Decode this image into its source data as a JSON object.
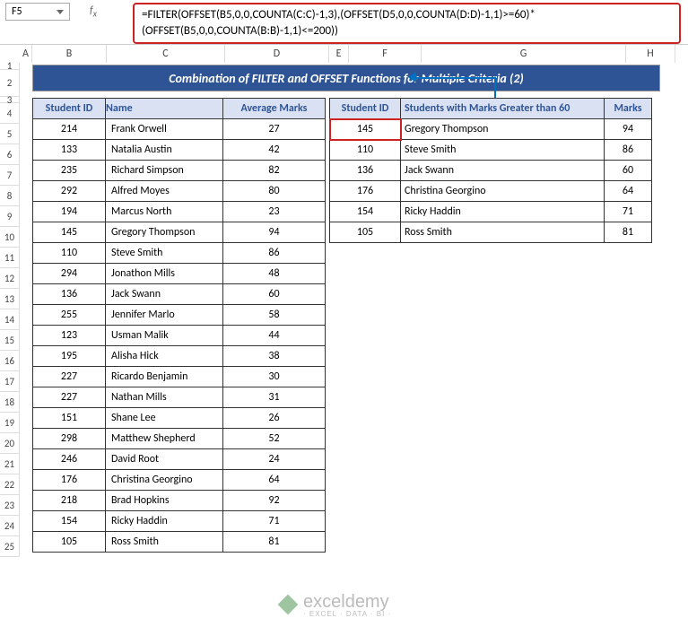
{
  "nameBox": "F5",
  "formula": "=FILTER(OFFSET(B5,0,0,COUNTA(C:C)-1,3),(OFFSET(D5,0,0,COUNTA(D:D)-1,1)>=60)*(OFFSET(B5,0,0,COUNTA(B:B)-1,1)<=200))",
  "cols": [
    "A",
    "B",
    "C",
    "D",
    "E",
    "F",
    "G",
    "H"
  ],
  "rowNums": [
    "1",
    "2",
    "3",
    "4",
    "5",
    "6",
    "7",
    "8",
    "9",
    "10",
    "11",
    "12",
    "13",
    "14",
    "15",
    "16",
    "17",
    "18",
    "19",
    "20",
    "21",
    "22",
    "23",
    "24",
    "25"
  ],
  "title": "Combination of FILTER and OFFSET Functions for Multiple Criteria (2)",
  "t1h": {
    "id": "Student ID",
    "name": "Name",
    "am": "Average Marks"
  },
  "t1": [
    {
      "id": "214",
      "name": "Frank Orwell",
      "am": "27"
    },
    {
      "id": "133",
      "name": "Natalia Austin",
      "am": "42"
    },
    {
      "id": "235",
      "name": "Richard Simpson",
      "am": "82"
    },
    {
      "id": "292",
      "name": "Alfred Moyes",
      "am": "80"
    },
    {
      "id": "194",
      "name": "Marcus North",
      "am": "23"
    },
    {
      "id": "145",
      "name": "Gregory Thompson",
      "am": "94"
    },
    {
      "id": "110",
      "name": "Steve Smith",
      "am": "86"
    },
    {
      "id": "294",
      "name": "Jonathon Mills",
      "am": "48"
    },
    {
      "id": "136",
      "name": "Jack Swann",
      "am": "60"
    },
    {
      "id": "255",
      "name": "Jennifer Marlo",
      "am": "58"
    },
    {
      "id": "123",
      "name": "Usman Malik",
      "am": "44"
    },
    {
      "id": "195",
      "name": "Alisha Hick",
      "am": "38"
    },
    {
      "id": "227",
      "name": "Ricardo Benjamin",
      "am": "30"
    },
    {
      "id": "227",
      "name": "Nathan Mills",
      "am": "31"
    },
    {
      "id": "151",
      "name": "Shane Lee",
      "am": "26"
    },
    {
      "id": "298",
      "name": "Matthew Shepherd",
      "am": "52"
    },
    {
      "id": "246",
      "name": "David Root",
      "am": "24"
    },
    {
      "id": "176",
      "name": "Christina Georgino",
      "am": "64"
    },
    {
      "id": "218",
      "name": "Brad Hopkins",
      "am": "92"
    },
    {
      "id": "154",
      "name": "Ricky Haddin",
      "am": "71"
    },
    {
      "id": "105",
      "name": "Ross Smith",
      "am": "81"
    }
  ],
  "t2h": {
    "id": "Student ID",
    "st": "Students with Marks Greater than 60",
    "mk": "Marks"
  },
  "t2": [
    {
      "id": "145",
      "name": "Gregory Thompson",
      "mk": "94"
    },
    {
      "id": "110",
      "name": "Steve Smith",
      "mk": "86"
    },
    {
      "id": "136",
      "name": "Jack Swann",
      "mk": "60"
    },
    {
      "id": "176",
      "name": "Christina Georgino",
      "mk": "64"
    },
    {
      "id": "154",
      "name": "Ricky Haddin",
      "mk": "71"
    },
    {
      "id": "105",
      "name": "Ross Smith",
      "mk": "81"
    }
  ],
  "wm": {
    "brand": "exceldemy",
    "tag": "· EXCEL · DATA · BI ·"
  }
}
